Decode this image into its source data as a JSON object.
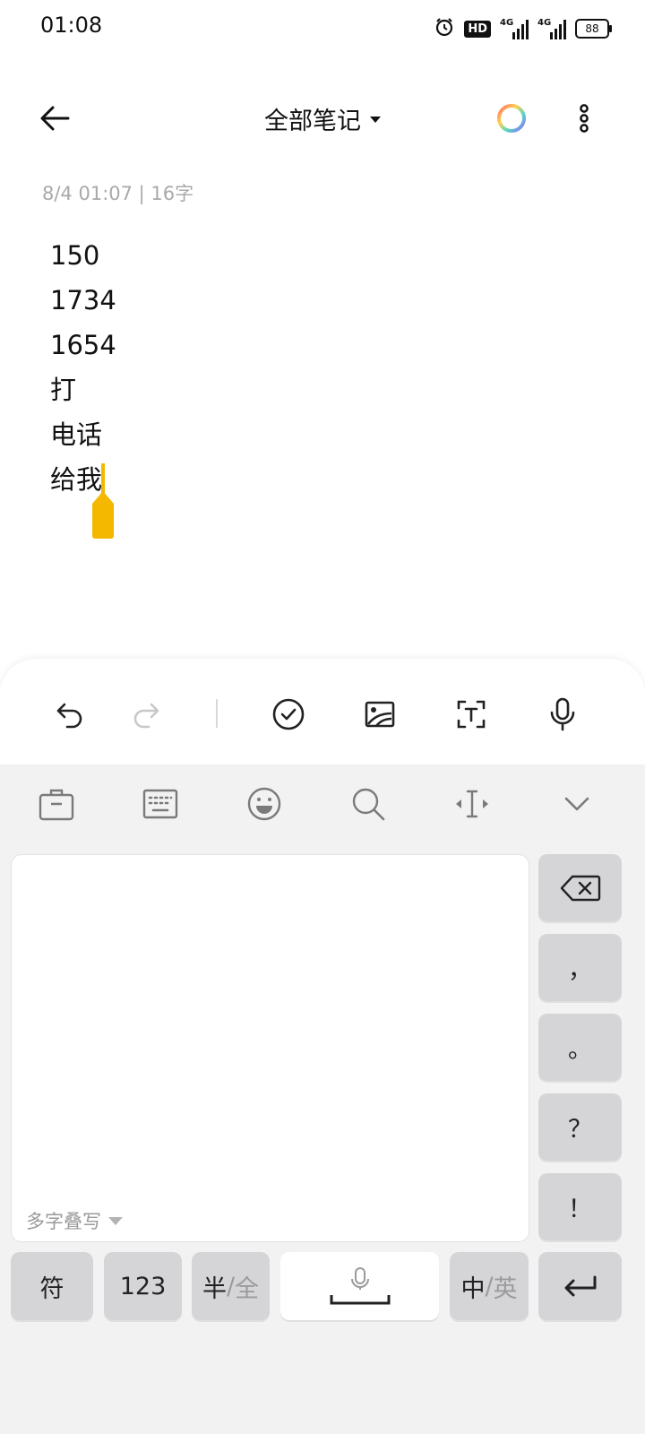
{
  "status_bar": {
    "time": "01:08",
    "hd_label": "HD",
    "network_1": "4G",
    "network_2": "4G",
    "battery": "88"
  },
  "header": {
    "title": "全部笔记",
    "icons": [
      "back-arrow-icon",
      "dropdown-caret-icon",
      "color-wheel-icon",
      "more-vertical-icon"
    ]
  },
  "note": {
    "meta": "8/4 01:07 | 16字",
    "lines": [
      "150",
      "1734",
      "1654",
      "打",
      "电话",
      "给我"
    ]
  },
  "toolbar": {
    "icons": [
      "undo-icon",
      "redo-icon",
      "checklist-icon",
      "image-icon",
      "text-scan-icon",
      "microphone-icon"
    ]
  },
  "keyboard": {
    "top_icons": [
      "toolbox-icon",
      "keyboard-icon",
      "emoji-icon",
      "search-icon",
      "cursor-move-icon",
      "collapse-icon"
    ],
    "handwriting_mode": "多字叠写",
    "keys": {
      "comma": "，",
      "period": "。",
      "question": "？",
      "exclamation": "！",
      "symbols": "符",
      "numbers": "123",
      "half": "半",
      "slash": "/",
      "full": "全",
      "chinese": "中",
      "english": "英"
    },
    "accent_color": "#f4b800"
  }
}
